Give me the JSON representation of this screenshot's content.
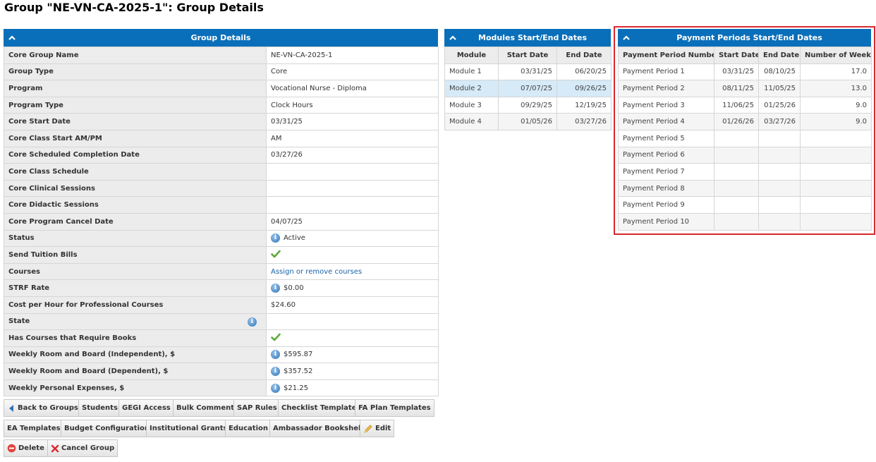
{
  "page": {
    "title": "Group \"NE-VN-CA-2025-1\": Group Details"
  },
  "group_details": {
    "header": "Group Details",
    "rows": [
      {
        "label": "Core Group Name",
        "value": "NE-VN-CA-2025-1"
      },
      {
        "label": "Group Type",
        "value": "Core"
      },
      {
        "label": "Program",
        "value": "Vocational Nurse - Diploma"
      },
      {
        "label": "Program Type",
        "value": "Clock Hours"
      },
      {
        "label": "Core Start Date",
        "value": "03/31/25"
      },
      {
        "label": "Core Class Start AM/PM",
        "value": "AM"
      },
      {
        "label": "Core Scheduled Completion Date",
        "value": "03/27/26"
      },
      {
        "label": "Core Class Schedule",
        "value": ""
      },
      {
        "label": "Core Clinical Sessions",
        "value": ""
      },
      {
        "label": "Core Didactic Sessions",
        "value": ""
      },
      {
        "label": "Core Program Cancel Date",
        "value": "04/07/25"
      },
      {
        "label": "Status",
        "value": "Active"
      },
      {
        "label": "Send Tuition Bills",
        "value": ""
      },
      {
        "label": "Courses",
        "value": "Assign or remove courses"
      },
      {
        "label": "STRF Rate",
        "value": "$0.00"
      },
      {
        "label": "Cost per Hour for Professional Courses",
        "value": "$24.60"
      },
      {
        "label": "State",
        "value": ""
      },
      {
        "label": "Has Courses that Require Books",
        "value": ""
      },
      {
        "label": "Weekly Room and Board (Independent), $",
        "value": "$595.87"
      },
      {
        "label": "Weekly Room and Board (Dependent), $",
        "value": "$357.52"
      },
      {
        "label": "Weekly Personal Expenses, $",
        "value": "$21.25"
      }
    ]
  },
  "modules": {
    "header": "Modules Start/End Dates",
    "columns": [
      "Module",
      "Start Date",
      "End Date"
    ],
    "rows": [
      {
        "module": "Module 1",
        "start": "03/31/25",
        "end": "06/20/25"
      },
      {
        "module": "Module 2",
        "start": "07/07/25",
        "end": "09/26/25"
      },
      {
        "module": "Module 3",
        "start": "09/29/25",
        "end": "12/19/25"
      },
      {
        "module": "Module 4",
        "start": "01/05/26",
        "end": "03/27/26"
      }
    ]
  },
  "payment_periods": {
    "header": "Payment Periods Start/End Dates",
    "columns": [
      "Payment Period Number",
      "Start Date",
      "End Date",
      "Number of Weeks"
    ],
    "rows": [
      {
        "name": "Payment Period 1",
        "start": "03/31/25",
        "end": "08/10/25",
        "weeks": "17.0"
      },
      {
        "name": "Payment Period 2",
        "start": "08/11/25",
        "end": "11/05/25",
        "weeks": "13.0"
      },
      {
        "name": "Payment Period 3",
        "start": "11/06/25",
        "end": "01/25/26",
        "weeks": "9.0"
      },
      {
        "name": "Payment Period 4",
        "start": "01/26/26",
        "end": "03/27/26",
        "weeks": "9.0"
      },
      {
        "name": "Payment Period 5",
        "start": "",
        "end": "",
        "weeks": ""
      },
      {
        "name": "Payment Period 6",
        "start": "",
        "end": "",
        "weeks": ""
      },
      {
        "name": "Payment Period 7",
        "start": "",
        "end": "",
        "weeks": ""
      },
      {
        "name": "Payment Period 8",
        "start": "",
        "end": "",
        "weeks": ""
      },
      {
        "name": "Payment Period 9",
        "start": "",
        "end": "",
        "weeks": ""
      },
      {
        "name": "Payment Period 10",
        "start": "",
        "end": "",
        "weeks": ""
      }
    ]
  },
  "buttons": {
    "back_to_groups": "Back to Groups",
    "students": "Students",
    "gegi_access": "GEGI Access",
    "bulk_comment": "Bulk Comment",
    "sap_rules": "SAP Rules",
    "checklist_template": "Checklist Template",
    "fa_plan_templates": "FA Plan Templates",
    "ea_templates": "EA Templates",
    "budget_configuration": "Budget Configuration",
    "institutional_grants": "Institutional Grants",
    "education": "Education",
    "ambassador_bookshelf": "Ambassador Bookshelf",
    "edit": "Edit",
    "delete": "Delete",
    "cancel_group": "Cancel Group"
  },
  "colors": {
    "header_blue": "#0a6fba",
    "highlight_red": "#d9282e",
    "selected_row": "#d6eaf8",
    "check_green": "#5aab3c",
    "link_blue": "#1762a8"
  },
  "icons": {
    "collapse": "chevron-up-icon",
    "info": "info-icon",
    "check": "check-icon",
    "back": "arrow-left-icon",
    "edit": "pencil-icon",
    "delete": "minus-circle-icon",
    "cancel": "x-icon"
  }
}
